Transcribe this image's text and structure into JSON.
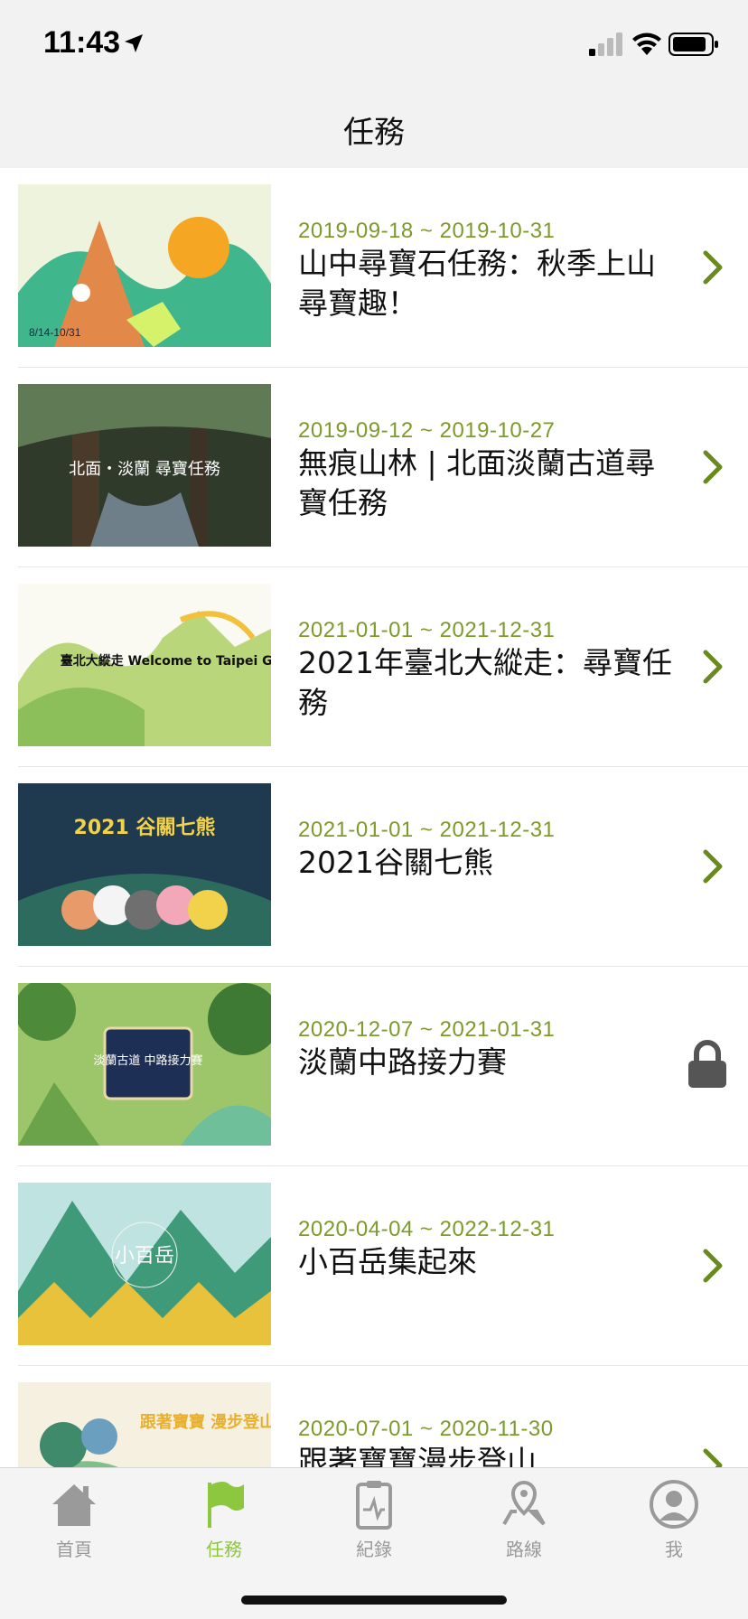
{
  "status_bar": {
    "time": "11:43"
  },
  "nav": {
    "title": "任務"
  },
  "missions": [
    {
      "date": "2019-09-18 ~ 2019-10-31",
      "title": "山中尋寶石任務：秋季上山尋寶趣！",
      "thumb_text": "8/14-10/31",
      "locked": false
    },
    {
      "date": "2019-09-12 ~ 2019-10-27",
      "title": "無痕山林 | 北面淡蘭古道尋寶任務",
      "thumb_text": "北面・淡蘭 尋寶任務",
      "locked": false
    },
    {
      "date": "2021-01-01 ~ 2021-12-31",
      "title": "2021年臺北大縱走：尋寶任務",
      "thumb_text": "臺北大縱走 Welcome to Taipei Grand Trail!",
      "locked": false
    },
    {
      "date": "2021-01-01 ~ 2021-12-31",
      "title": "2021谷關七熊",
      "thumb_text": "2021 谷關七熊",
      "locked": false
    },
    {
      "date": "2020-12-07 ~ 2021-01-31",
      "title": "淡蘭中路接力賽",
      "thumb_text": "淡蘭古道 中路接力賽",
      "locked": true
    },
    {
      "date": "2020-04-04 ~ 2022-12-31",
      "title": "小百岳集起來",
      "thumb_text": "小百岳",
      "locked": false
    },
    {
      "date": "2020-07-01 ~ 2020-11-30",
      "title": "跟著寶寶漫步登山",
      "thumb_text": "跟著寶寶 漫步登山",
      "locked": false
    }
  ],
  "tabs": [
    {
      "label": "首頁",
      "icon": "home-icon",
      "active": false
    },
    {
      "label": "任務",
      "icon": "flag-icon",
      "active": true
    },
    {
      "label": "紀錄",
      "icon": "clipboard-icon",
      "active": false
    },
    {
      "label": "路線",
      "icon": "map-pin-icon",
      "active": false
    },
    {
      "label": "我",
      "icon": "person-icon",
      "active": false
    }
  ],
  "colors": {
    "accent": "#7d9a2a",
    "tab_active": "#8dc63f",
    "tab_inactive": "#9a9a9a"
  }
}
